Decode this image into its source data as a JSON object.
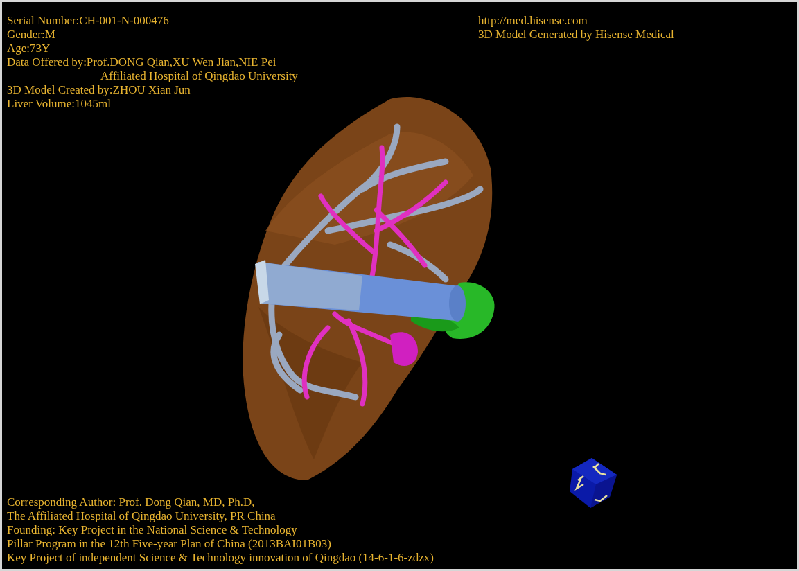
{
  "header_left": [
    {
      "text": "Serial Number:CH-001-N-000476",
      "kind": "line"
    },
    {
      "text": "Gender:M",
      "kind": "line"
    },
    {
      "text": "Age:73Y",
      "kind": "line"
    },
    {
      "text": "Data Offered by:Prof.DONG Qian,XU Wen Jian,NIE Pei",
      "kind": "line"
    },
    {
      "text": "Affiliated Hospital of Qingdao University",
      "kind": "continuation"
    },
    {
      "text": "3D Model Created by:ZHOU Xian Jun",
      "kind": "line"
    },
    {
      "text": "Liver Volume:1045ml",
      "kind": "line"
    }
  ],
  "header_right": {
    "link": "http://med.hisense.com",
    "credit": "3D Model Generated by Hisense Medical"
  },
  "footer": [
    "Corresponding Author: Prof. Dong Qian, MD, Ph.D,",
    "The Affiliated Hospital of Qingdao University, PR China",
    "Founding: Key Project in the National Science & Technology",
    "Pillar Program in the 12th Five-year Plan of China (2013BAI01B03)",
    "Key Project of independent Science & Technology innovation of Qingdao (14-6-1-6-zdzx)"
  ]
}
